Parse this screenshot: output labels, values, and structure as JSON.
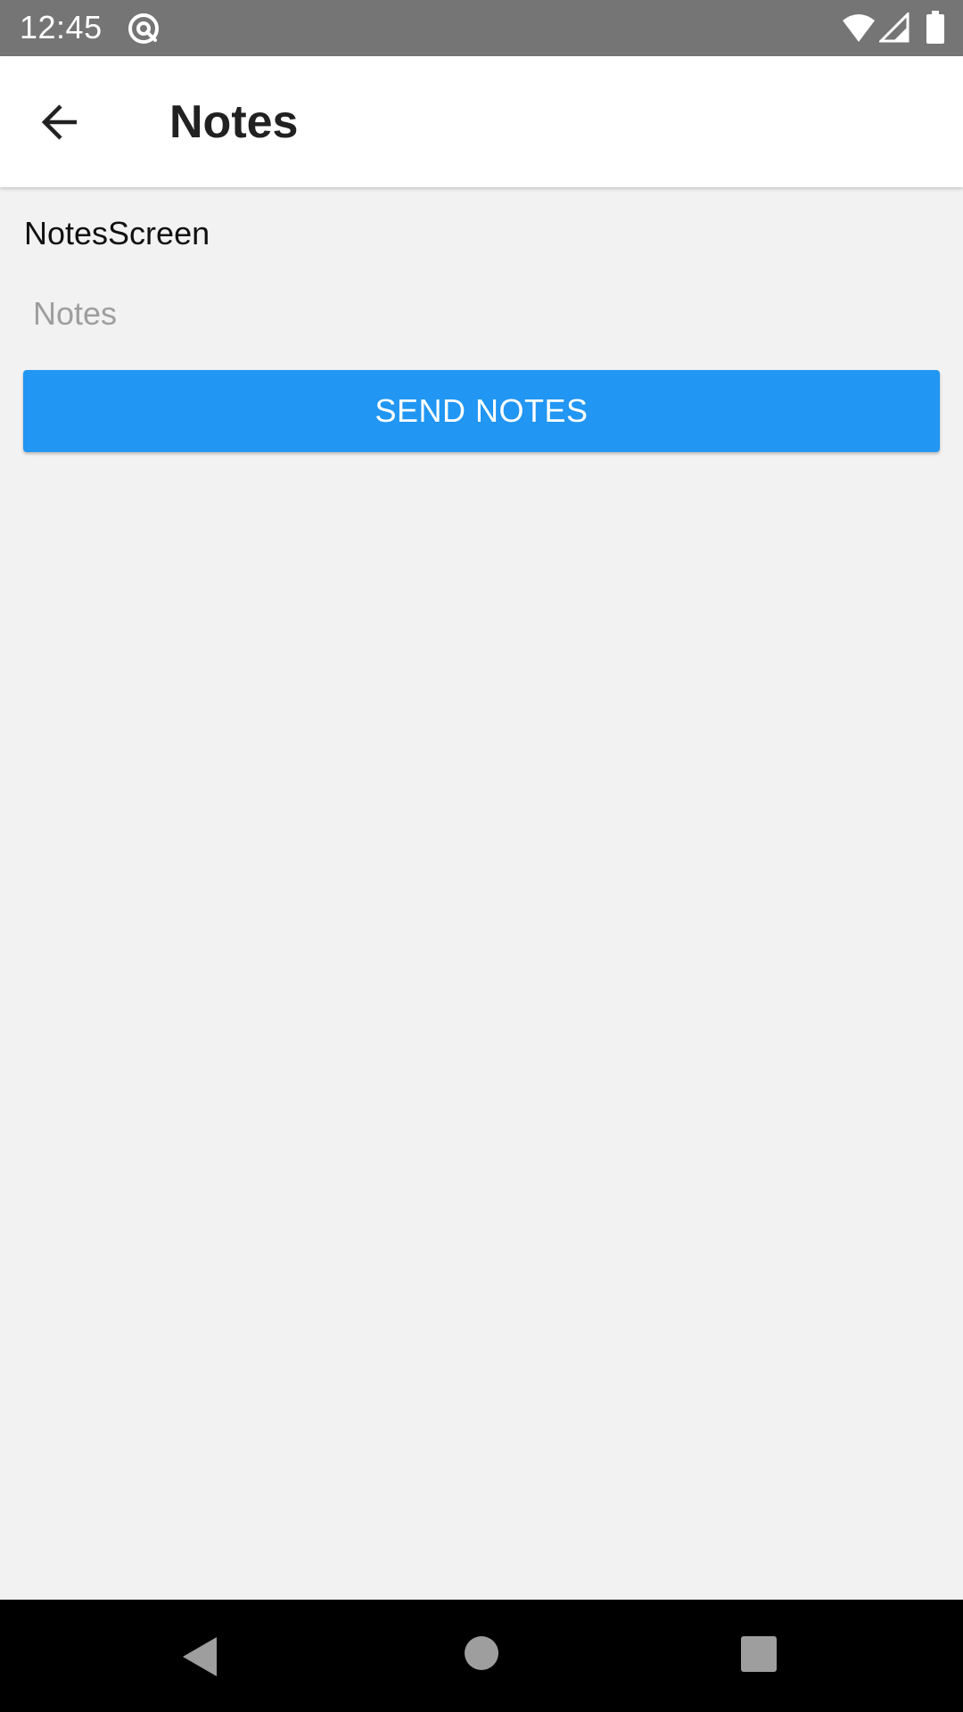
{
  "status_bar": {
    "time": "12:45",
    "icons": [
      "at-sign-icon",
      "wifi-icon",
      "signal-icon",
      "battery-icon"
    ]
  },
  "app_bar": {
    "title": "Notes",
    "back_icon": "arrow-left-icon"
  },
  "content": {
    "screen_label": "NotesScreen",
    "notes_input": {
      "value": "",
      "placeholder": "Notes"
    },
    "send_button_label": "SEND NOTES"
  },
  "nav_bar": {
    "icons": [
      "nav-back-icon",
      "nav-home-icon",
      "nav-recents-icon"
    ]
  },
  "colors": {
    "status_bar": "#757575",
    "app_bar": "#ffffff",
    "background": "#f2f2f2",
    "accent": "#2196f3",
    "nav_bar": "#000000"
  }
}
